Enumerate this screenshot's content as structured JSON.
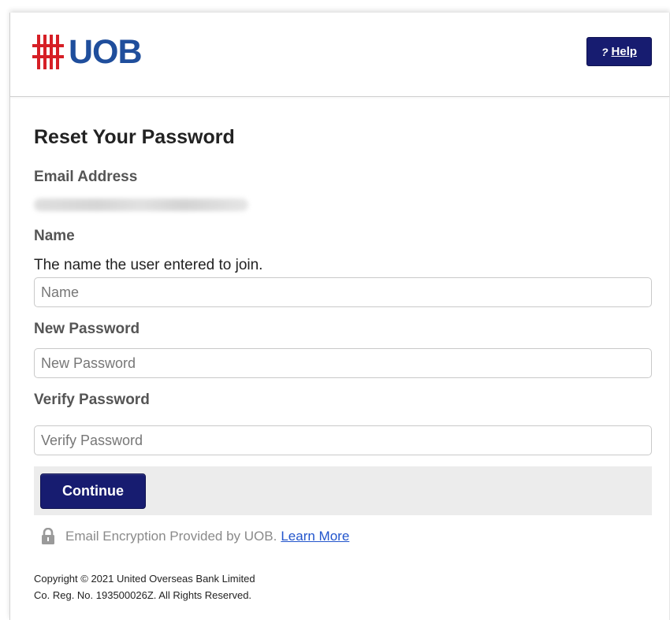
{
  "brand": {
    "name": "UOB",
    "primary_color": "#171c70",
    "logo_text_color": "#1f4e9c",
    "logo_mark_color": "#d61f26"
  },
  "header": {
    "help_icon": "?",
    "help_label": "Help"
  },
  "form": {
    "title": "Reset Your Password",
    "email_label": "Email Address",
    "email_value": "",
    "name_label": "Name",
    "name_description": "The name the user entered to join.",
    "name_placeholder": "Name",
    "new_password_label": "New Password",
    "new_password_placeholder": "New Password",
    "verify_password_label": "Verify Password",
    "verify_password_placeholder": "Verify Password",
    "continue_label": "Continue"
  },
  "footer": {
    "encryption_text": "Email Encryption Provided by UOB.",
    "learn_more_label": "Learn More",
    "copyright_line1": "Copyright © 2021 United Overseas Bank Limited",
    "copyright_line2": "Co. Reg. No. 193500026Z. All Rights Reserved."
  },
  "icons": {
    "lock": "lock-icon",
    "help": "help-icon"
  }
}
